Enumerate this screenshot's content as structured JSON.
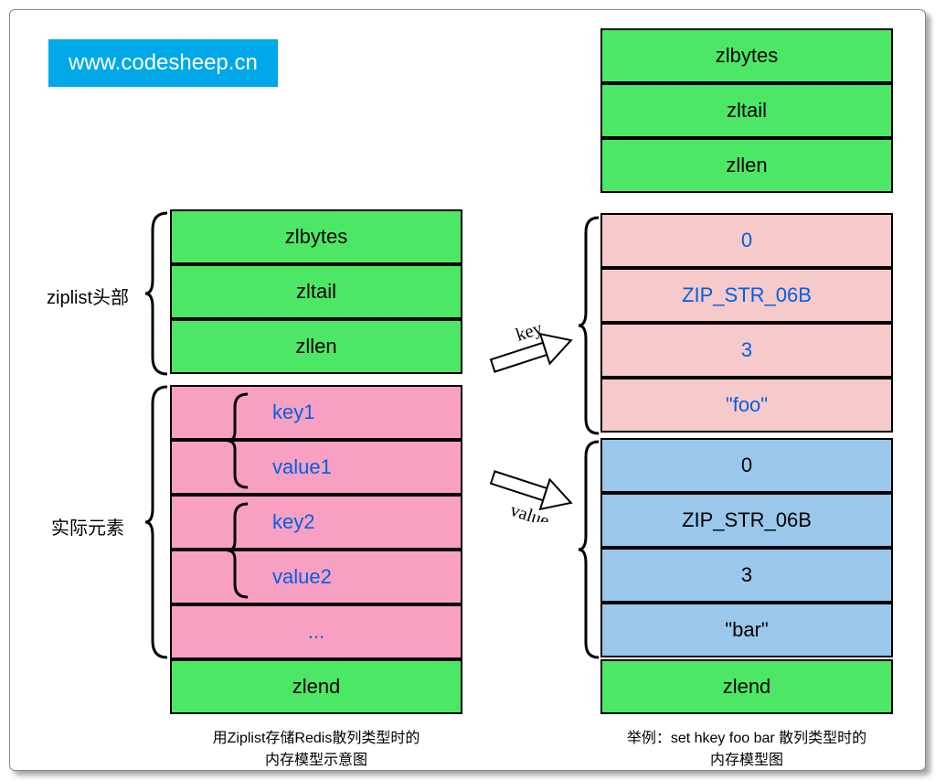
{
  "watermark": "www.codesheep.cn",
  "left": {
    "header_label": "ziplist头部",
    "elem_label": "实际元素",
    "cells": {
      "zlbytes": "zlbytes",
      "zltail": "zltail",
      "zllen": "zllen",
      "key1": "key1",
      "value1": "value1",
      "key2": "key2",
      "value2": "value2",
      "more": "...",
      "zlend": "zlend"
    },
    "caption_l1": "用Ziplist存储Redis散列类型时的",
    "caption_l2": "内存模型示意图"
  },
  "arrows": {
    "key": "key",
    "value": "value"
  },
  "right": {
    "cells": {
      "zlbytes": "zlbytes",
      "zltail": "zltail",
      "zllen": "zllen",
      "k0": "0",
      "kenc": "ZIP_STR_06B",
      "klen": "3",
      "kval": "\"foo\"",
      "v0": "0",
      "venc": "ZIP_STR_06B",
      "vlen": "3",
      "vval": "\"bar\"",
      "zlend": "zlend"
    },
    "caption_l1": "举例：set hkey foo bar 散列类型时的",
    "caption_l2": "内存模型图"
  }
}
